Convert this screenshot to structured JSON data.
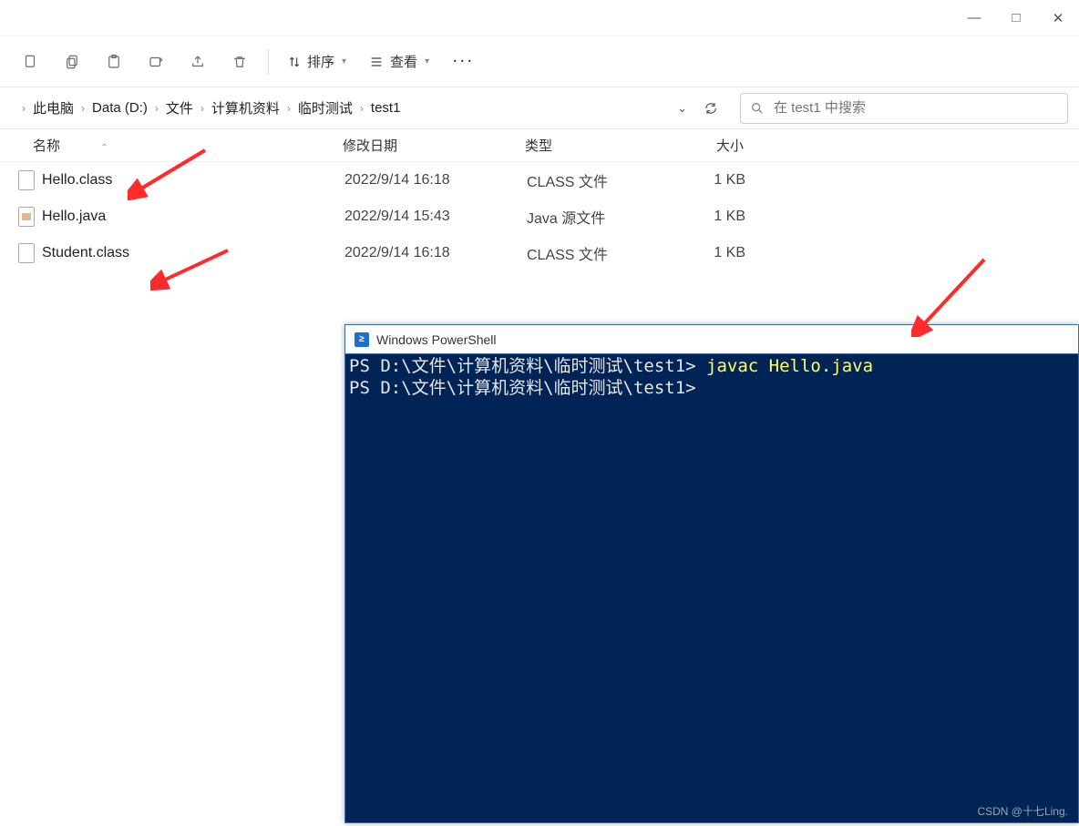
{
  "window_controls": {
    "min": "—",
    "max": "□",
    "close": "✕"
  },
  "toolbar": {
    "sort_label": "排序",
    "view_label": "查看"
  },
  "breadcrumb": [
    "此电脑",
    "Data (D:)",
    "文件",
    "计算机资料",
    "临时测试",
    "test1"
  ],
  "search_placeholder": "在 test1 中搜索",
  "columns": {
    "name": "名称",
    "date": "修改日期",
    "type": "类型",
    "size": "大小"
  },
  "files": [
    {
      "name": "Hello.class",
      "date": "2022/9/14 16:18",
      "type": "CLASS 文件",
      "size": "1 KB",
      "iconKind": "plain"
    },
    {
      "name": "Hello.java",
      "date": "2022/9/14 15:43",
      "type": "Java 源文件",
      "size": "1 KB",
      "iconKind": "java"
    },
    {
      "name": "Student.class",
      "date": "2022/9/14 16:18",
      "type": "CLASS 文件",
      "size": "1 KB",
      "iconKind": "plain"
    }
  ],
  "powershell": {
    "title": "Windows PowerShell",
    "prompt1_text": "PS D:\\文件\\计算机资料\\临时测试\\test1> ",
    "cmd1": "javac Hello.java",
    "prompt2_text": "PS D:\\文件\\计算机资料\\临时测试\\test1>"
  },
  "watermark": "CSDN @十七Ling."
}
